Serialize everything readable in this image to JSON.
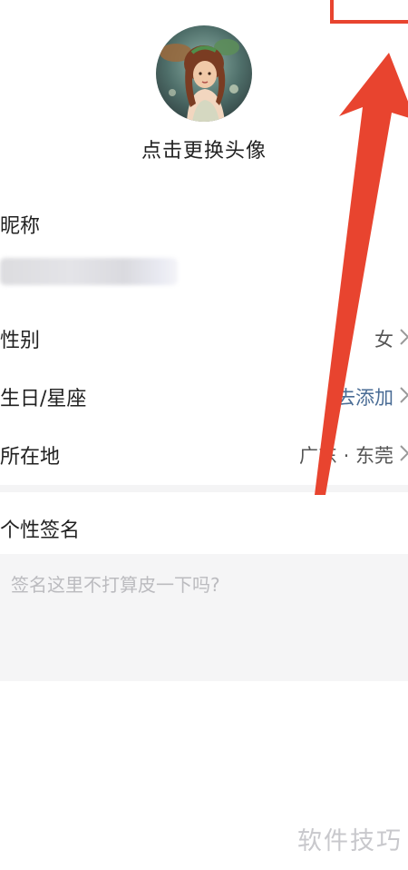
{
  "avatar": {
    "change_label": "点击更换头像"
  },
  "profile": {
    "nickname_label": "昵称",
    "gender_label": "性别",
    "gender_value": "女",
    "birthday_label": "生日/星座",
    "birthday_value": "去添加",
    "location_label": "所在地",
    "location_value": "广东 · 东莞",
    "signature_label": "个性签名",
    "signature_placeholder": "签名这里不打算皮一下吗?"
  },
  "watermark": "软件技巧",
  "colors": {
    "annotation": "#e8442f",
    "accent_value": "#4a6c95"
  },
  "icons": {
    "row_chevron": "chevron-right-icon"
  }
}
